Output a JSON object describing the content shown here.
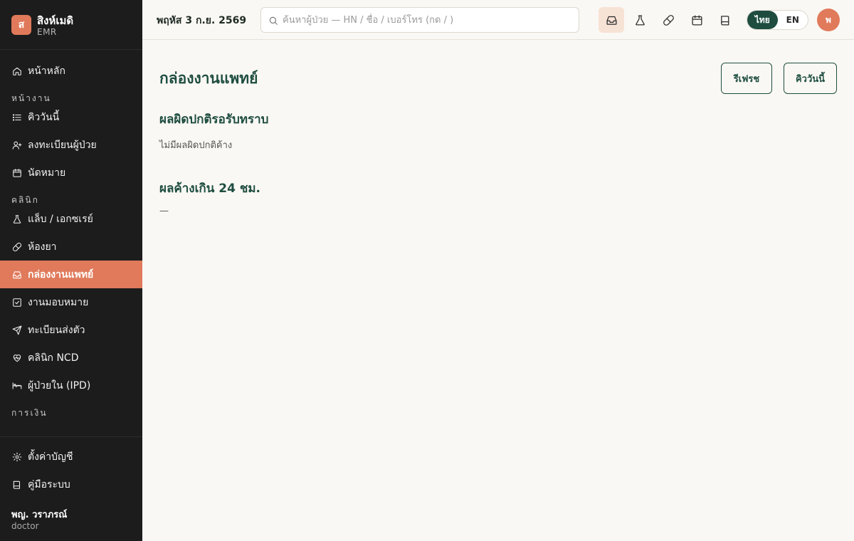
{
  "brand": {
    "logo_letter": "ส",
    "name": "สิงห์เมดิ",
    "sub": "EMR"
  },
  "sidebar": {
    "home": "หน้าหลัก",
    "sections": {
      "work": "หน้างาน",
      "clinic": "คลินิก",
      "finance": "การเงิน"
    },
    "work_items": [
      {
        "label": "คิววันนี้",
        "icon": "list-icon"
      },
      {
        "label": "ลงทะเบียนผู้ป่วย",
        "icon": "user-plus-icon"
      },
      {
        "label": "นัดหมาย",
        "icon": "calendar-icon"
      }
    ],
    "clinic_items": [
      {
        "label": "แล็บ / เอกซเรย์",
        "icon": "flask-icon"
      },
      {
        "label": "ห้องยา",
        "icon": "pill-icon"
      },
      {
        "label": "กล่องงานแพทย์",
        "icon": "inbox-icon"
      },
      {
        "label": "งานมอบหมาย",
        "icon": "check-square-icon"
      },
      {
        "label": "ทะเบียนส่งตัว",
        "icon": "send-icon"
      },
      {
        "label": "คลินิก NCD",
        "icon": "heart-pulse-icon"
      },
      {
        "label": "ผู้ป่วยใน (IPD)",
        "icon": "bed-icon"
      }
    ],
    "active": "กล่องงานแพทย์",
    "footer_items": [
      {
        "label": "ตั้งค่าบัญชี",
        "icon": "gear-icon"
      },
      {
        "label": "คู่มือระบบ",
        "icon": "book-icon"
      }
    ],
    "user": {
      "name": "พญ. วราภรณ์",
      "role": "doctor"
    }
  },
  "topbar": {
    "date": "พฤหัส 3 ก.ย. 2569",
    "search_placeholder": "ค้นหาผู้ป่วย — HN / ชื่อ / เบอร์โทร (กด / )",
    "lang_th": "ไทย",
    "lang_en": "EN",
    "active_lang": "ไทย",
    "avatar_letter": "พ"
  },
  "main": {
    "title": "กล่องงานแพทย์",
    "refresh_label": "รีเฟรช",
    "queue_label": "คิววันนี้",
    "abnormal_title": "ผลผิดปกติรอรับทราบ",
    "abnormal_text": "ไม่มีผลผิดปกติค้าง",
    "pending_title": "ผลค้างเกิน 24 ชม.",
    "pending_text": "—"
  },
  "colors": {
    "accent": "#e07a5b",
    "primary": "#1e4d40",
    "sidebar_bg": "#1c1c1c",
    "page_bg": "#faf8f4"
  }
}
